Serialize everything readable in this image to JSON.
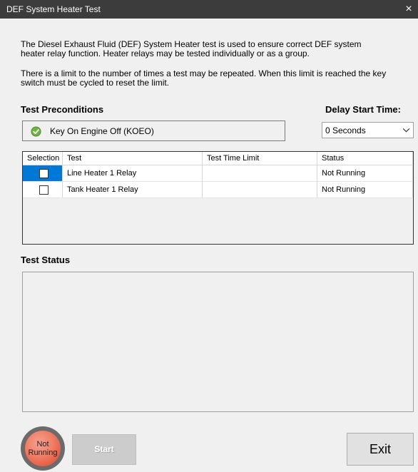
{
  "window": {
    "title": "DEF System Heater Test",
    "close_glyph": "×"
  },
  "description": {
    "para1_line1": "The Diesel Exhaust Fluid (DEF) System Heater test is used to ensure correct DEF system",
    "para1_line2": "heater relay function. Heater relays may be tested individually or as a group.",
    "para2_line1": "There is a limit to the number of times a test may be repeated. When this limit is reached the key",
    "para2_line2": "switch must be cycled to reset the limit."
  },
  "preconditions": {
    "heading": "Test Preconditions",
    "item_label": "Key On Engine Off (KOEO)",
    "item_icon": "check-circle-icon",
    "item_color": "#5a9e2f"
  },
  "delay": {
    "heading": "Delay Start Time:",
    "selected": "0 Seconds"
  },
  "grid": {
    "columns": [
      "Selection",
      "Test",
      "Test Time Limit",
      "Status"
    ],
    "rows": [
      {
        "test": "Line Heater 1 Relay",
        "time_limit": "",
        "status": "Not Running",
        "selected": true
      },
      {
        "test": "Tank Heater 1 Relay",
        "time_limit": "",
        "status": "Not Running",
        "selected": false
      }
    ],
    "selection_color": "#0078d7"
  },
  "test_status": {
    "heading": "Test Status"
  },
  "indicator": {
    "line1": "Not",
    "line2": "Running",
    "color": "#e0412a"
  },
  "buttons": {
    "start": "Start",
    "exit": "Exit"
  }
}
